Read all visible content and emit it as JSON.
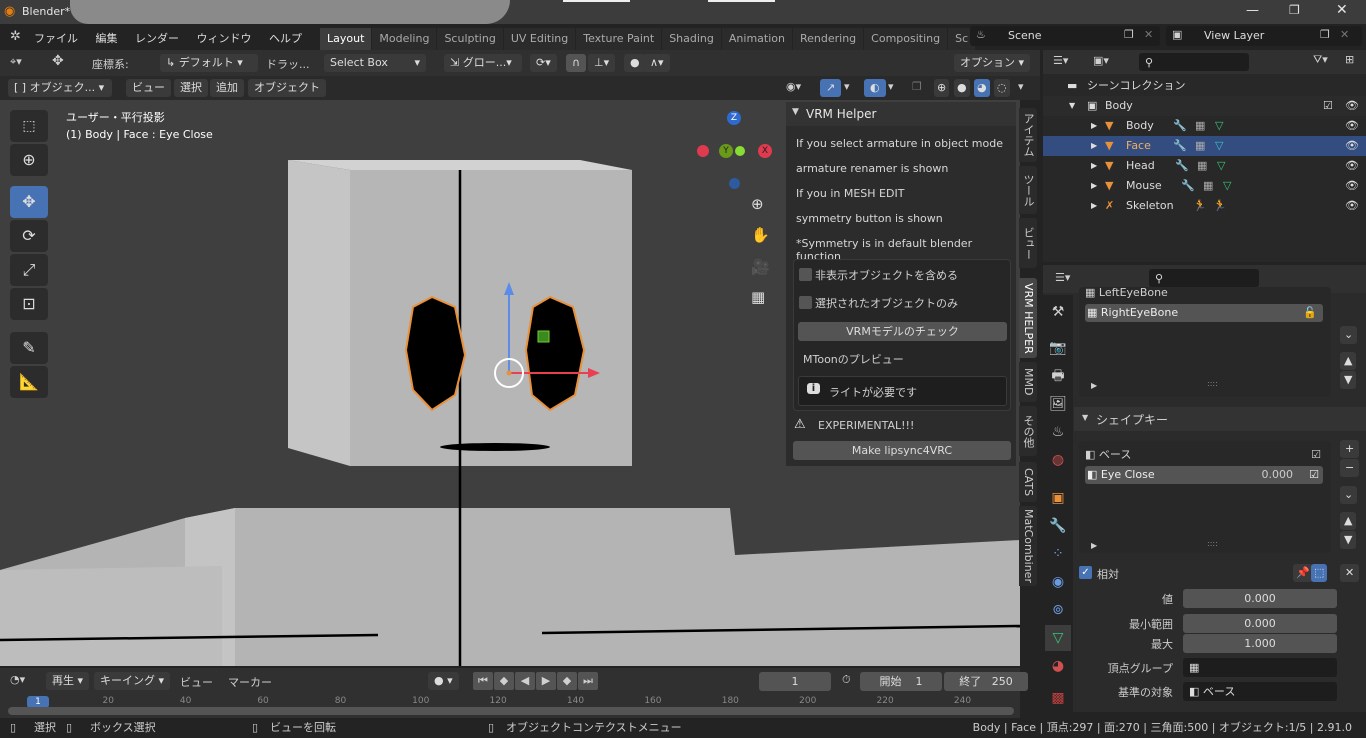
{
  "window": {
    "title": "Blender*",
    "controls": [
      "minimize",
      "maximize",
      "close"
    ]
  },
  "menu": [
    "ファイル",
    "編集",
    "レンダー",
    "ウィンドウ",
    "ヘルプ"
  ],
  "workspaces": [
    "Layout",
    "Modeling",
    "Sculpting",
    "UV Editing",
    "Texture Paint",
    "Shading",
    "Animation",
    "Rendering",
    "Compositing",
    "Sc"
  ],
  "active_workspace": "Layout",
  "scene": {
    "name": "Scene",
    "view_layer": "View Layer"
  },
  "tool_header": {
    "orientation_label": "座標系:",
    "orientation": "デフォルト",
    "drag": "ドラッ...",
    "select_mode": "Select Box",
    "transform": "グロー...",
    "options": "オプション"
  },
  "viewport_header": {
    "mode": "オブジェク...",
    "items": [
      "ビュー",
      "選択",
      "追加",
      "オブジェクト"
    ]
  },
  "viewport": {
    "view_name": "ユーザー・平行投影",
    "object_info": "(1) Body | Face : Eye Close",
    "gizmo": {
      "z": "Z",
      "y": "Y",
      "x": "X"
    }
  },
  "vrm_helper": {
    "title": "VRM Helper",
    "lines": [
      "If you select armature in object mode",
      "armature renamer is shown",
      "If you in MESH EDIT",
      "symmetry button is shown",
      "*Symmetry is in default blender function"
    ],
    "checkbox_hidden": "非表示オブジェクトを含める",
    "checkbox_selected": "選択されたオブジェクトのみ",
    "check_button": "VRMモデルのチェック",
    "mtoon": "MToonのプレビュー",
    "info": "ライトが必要です",
    "experimental": "EXPERIMENTAL!!!",
    "lipsync_button": "Make lipsync4VRC"
  },
  "side_tabs": [
    "アイテム",
    "ツール",
    "ビュー",
    "VRM HELPER",
    "MMD",
    "その他",
    "CATS",
    "MatCombiner"
  ],
  "active_side_tab": "VRM HELPER",
  "outliner": {
    "root": "シーンコレクション",
    "collection": "Body",
    "items": [
      {
        "name": "Body",
        "type": "mesh",
        "selected": false
      },
      {
        "name": "Face",
        "type": "mesh",
        "selected": true
      },
      {
        "name": "Head",
        "type": "mesh",
        "selected": false
      },
      {
        "name": "Mouse",
        "type": "mesh",
        "selected": false
      },
      {
        "name": "Skeleton",
        "type": "armature",
        "selected": false
      }
    ]
  },
  "properties": {
    "vertex_groups": [
      "LeftEyeBone",
      "RightEyeBone"
    ],
    "active_vertex_group": "RightEyeBone",
    "shape_keys_title": "シェイプキー",
    "shape_keys": [
      {
        "name": "ベース",
        "value": ""
      },
      {
        "name": "Eye Close",
        "value": "0.000"
      }
    ],
    "relative_label": "相対",
    "relative": true,
    "value_label": "値",
    "value": "0.000",
    "min_label": "最小範囲",
    "min": "0.000",
    "max_label": "最大",
    "max": "1.000",
    "vgroup_label": "頂点グループ",
    "relative_to_label": "基準の対象",
    "relative_to": "ベース"
  },
  "timeline": {
    "menus": [
      "再生",
      "キーイング",
      "ビュー",
      "マーカー"
    ],
    "current_frame": "1",
    "start_label": "開始",
    "start": "1",
    "end_label": "終了",
    "end": "250",
    "ticks": [
      "20",
      "40",
      "60",
      "80",
      "100",
      "120",
      "140",
      "160",
      "180",
      "200",
      "220",
      "240"
    ],
    "playhead": "1"
  },
  "status": {
    "select": "選択",
    "box_select": "ボックス選択",
    "rotate": "ビューを回転",
    "context_menu": "オブジェクトコンテクストメニュー",
    "stats": "Body | Face | 頂点:297 | 面:270 | 三角面:500 | オブジェクト:1/5 | 2.91.0"
  },
  "colors": {
    "accent": "#4772b3",
    "selected_row": "#334d80",
    "orange": "#e8903a",
    "mesh_data": "#39c47a",
    "panel": "#2c2c2c"
  }
}
